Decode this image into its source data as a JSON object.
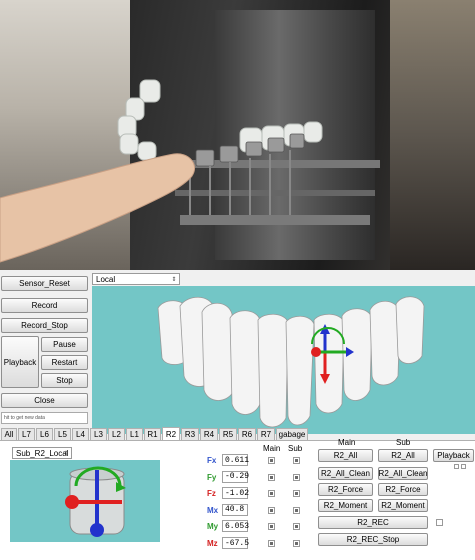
{
  "left_panel": {
    "sensor_reset": "Sensor_Reset",
    "record": "Record",
    "record_stop": "Record_Stop",
    "playback": "Playback",
    "pause": "Pause",
    "restart": "Restart",
    "stop": "Stop",
    "close": "Close",
    "hint": "hit to get new data"
  },
  "view_select": {
    "value": "Local"
  },
  "tabs": [
    "All",
    "L7",
    "L6",
    "L5",
    "L4",
    "L3",
    "L2",
    "L1",
    "R1",
    "R2",
    "R3",
    "R4",
    "R5",
    "R6",
    "R7",
    "gabage"
  ],
  "active_tab": "R2",
  "sub_select": {
    "value": "Sub_R2_Local"
  },
  "table": {
    "main_header": "Main",
    "sub_header": "Sub",
    "rows": [
      {
        "label": "Fx",
        "color": "#3355cc",
        "value": "0.611"
      },
      {
        "label": "Fy",
        "color": "#2e9a2e",
        "value": "-0.29"
      },
      {
        "label": "Fz",
        "color": "#d42020",
        "value": "-1.02"
      },
      {
        "label": "Mx",
        "color": "#3355cc",
        "value": "40.8"
      },
      {
        "label": "My",
        "color": "#2e9a2e",
        "value": "6.053"
      },
      {
        "label": "Mz",
        "color": "#d42020",
        "value": "-67.5"
      }
    ]
  },
  "actions": {
    "main_header": "Main",
    "sub_header": "Sub",
    "r2_all": "R2_All",
    "r2_all_sub": "R2_All",
    "r2_all_clean": "R2_All_Clean",
    "r2_all_clean_sub": "R2_All_Clean",
    "r2_force": "R2_Force",
    "r2_force_sub": "R2_Force",
    "r2_moment": "R2_Moment",
    "r2_moment_sub": "R2_Moment",
    "r2_rec": "R2_REC",
    "r2_rec_stop": "R2_REC_Stop",
    "playback": "Playback"
  },
  "colors": {
    "viewport": "#73c6c6",
    "axis_x": "#e02020",
    "axis_y": "#22aa22",
    "axis_z": "#2233cc"
  }
}
